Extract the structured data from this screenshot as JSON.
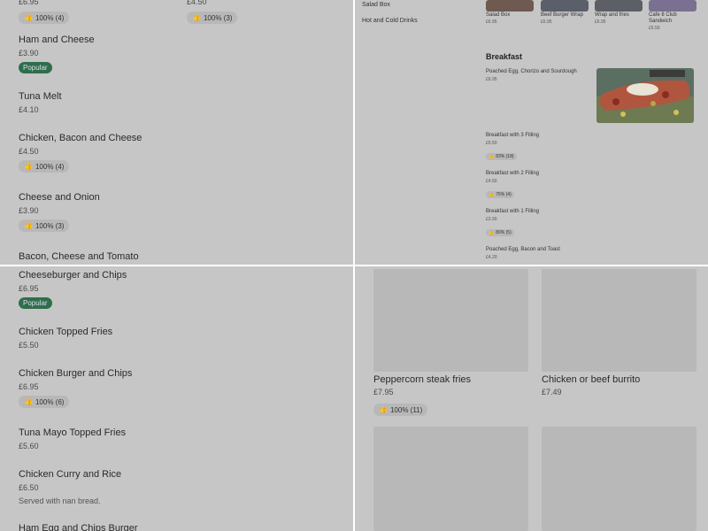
{
  "q1": {
    "items": [
      {
        "name": "",
        "price": "£6.95",
        "badge": "100% (4)"
      },
      {
        "name": "",
        "price": "£4.50",
        "badge": "100% (3)"
      },
      {
        "name": "Ham and Cheese",
        "price": "£3.90",
        "tag": "Popular"
      },
      {
        "name": "Tuna Melt",
        "price": "£4.10"
      },
      {
        "name": "Chicken, Bacon and Cheese",
        "price": "£4.50",
        "badge": "100% (4)"
      },
      {
        "name": "Cheese and Onion",
        "price": "£3.90",
        "badge": "100% (3)"
      },
      {
        "name": "Bacon, Cheese and Tomato"
      }
    ]
  },
  "q2": {
    "nav": [
      "Salad Box",
      "Hot and Cold Drinks"
    ],
    "cards": [
      {
        "name": "Salad Box",
        "price": "£6.95"
      },
      {
        "name": "Beef Burger Wrap",
        "price": "£6.95"
      },
      {
        "name": "Wrap and fries",
        "price": "£6.95"
      },
      {
        "name": "Cafe 8 Club Sandwich",
        "price": "£5.50"
      }
    ],
    "section_title": "Breakfast",
    "breakfast": [
      {
        "name": "Poached Egg, Chorizo and Sourdough",
        "price": "£6.95"
      },
      {
        "name": "Breakfast with 3 Filling",
        "price": "£5.50",
        "badge": "83% (18)"
      },
      {
        "name": "Breakfast with 2 Filling",
        "price": "£4.50",
        "badge": "75% (4)"
      },
      {
        "name": "Breakfast with 1 Filling",
        "price": "£3.90",
        "badge": "80% (5)"
      },
      {
        "name": "Poached Egg, Bacon and Toast",
        "price": "£4.20"
      }
    ]
  },
  "q3": {
    "items": [
      {
        "name": "Cheeseburger and Chips",
        "price": "£6.95",
        "tag": "Popular"
      },
      {
        "name": "Chicken Topped Fries",
        "price": "£5.50"
      },
      {
        "name": "Chicken Burger and Chips",
        "price": "£6.95",
        "badge": "100% (6)"
      },
      {
        "name": "Tuna Mayo Topped Fries",
        "price": "£5.60"
      },
      {
        "name": "Chicken Curry and Rice",
        "price": "£6.50",
        "note": "Served with nan bread."
      },
      {
        "name": "Ham Egg and Chips Burger"
      }
    ]
  },
  "q4": {
    "tiles": [
      {
        "name": "Peppercorn steak fries",
        "price": "£7.95",
        "badge": "100% (11)"
      },
      {
        "name": "Chicken or beef burrito",
        "price": "£7.49"
      }
    ]
  },
  "colors": {
    "overlay": "#c6c6c6",
    "popular": "#2f6e4b",
    "badge": "#b8b8b8",
    "divider": "#ffffff"
  }
}
